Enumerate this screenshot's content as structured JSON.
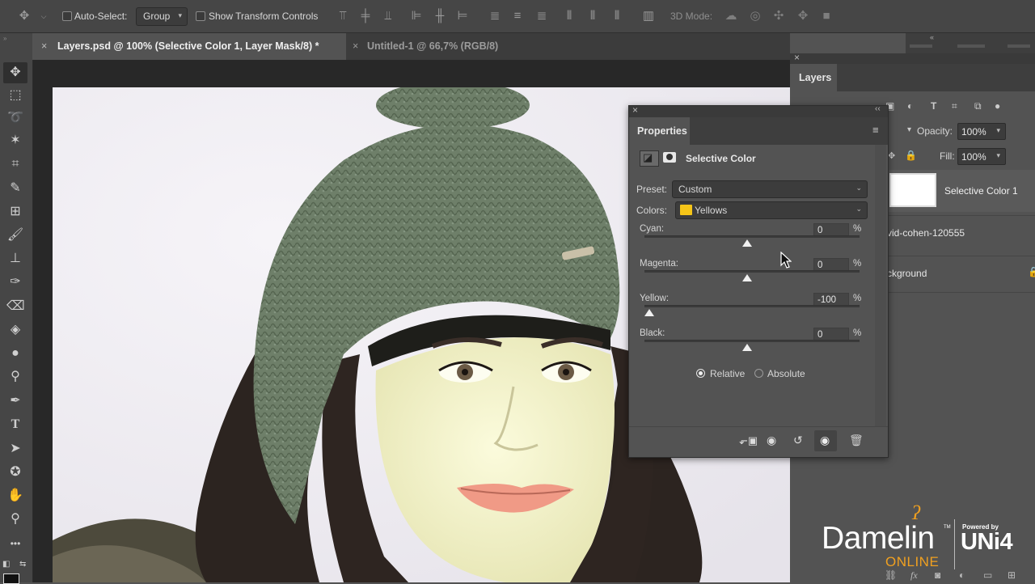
{
  "options_bar": {
    "auto_select_label": "Auto-Select:",
    "auto_select_value": "Group",
    "show_transform_label": "Show Transform Controls",
    "mode_3d_label": "3D Mode:"
  },
  "tabs": [
    {
      "label": "Layers.psd @ 100% (Selective Color 1, Layer Mask/8) *",
      "active": true
    },
    {
      "label": "Untitled-1 @ 66,7% (RGB/8)",
      "active": false
    }
  ],
  "layers_panel": {
    "title": "Layers",
    "opacity_label": "Opacity:",
    "opacity_value": "100%",
    "fill_label": "Fill:",
    "fill_value": "100%",
    "items": [
      {
        "name": "Selective Color 1"
      },
      {
        "name": "vid-cohen-120555"
      },
      {
        "name": "ckground"
      }
    ]
  },
  "properties_panel": {
    "title": "Properties",
    "adjustment_name": "Selective Color",
    "preset_label": "Preset:",
    "preset_value": "Custom",
    "colors_label": "Colors:",
    "colors_value": "Yellows",
    "colors_swatch": "#f5c518",
    "sliders": [
      {
        "label": "Cyan:",
        "value": "0",
        "unit": "%",
        "fraction": 0.5
      },
      {
        "label": "Magenta:",
        "value": "0",
        "unit": "%",
        "fraction": 0.5
      },
      {
        "label": "Yellow:",
        "value": "-100",
        "unit": "%",
        "fraction": 0.0
      },
      {
        "label": "Black:",
        "value": "0",
        "unit": "%",
        "fraction": 0.5
      }
    ],
    "method_relative": "Relative",
    "method_absolute": "Absolute",
    "selected_method": "Relative"
  },
  "watermark": {
    "brand": "Damelin",
    "tm": "TM",
    "sub": "ONLINE",
    "powered": "Powered by",
    "partner": "UNi4"
  },
  "colors": {
    "accent": "#f0a020",
    "panel_bg": "#535353",
    "ui_dark": "#3c3c3c"
  }
}
